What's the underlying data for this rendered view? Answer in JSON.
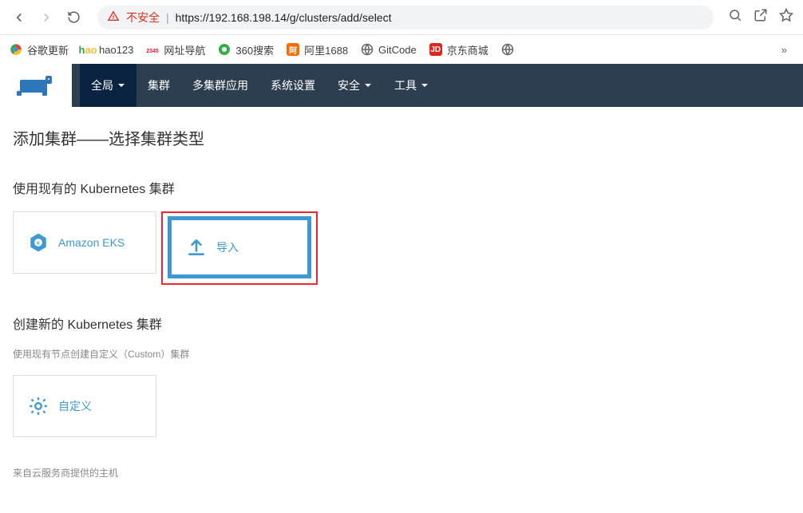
{
  "browser": {
    "insecure_label": "不安全",
    "url": "https://192.168.198.14/g/clusters/add/select"
  },
  "bookmarks": [
    {
      "label": "谷歌更新",
      "color": "#4285f4"
    },
    {
      "label": "hao123",
      "color": "#f8be30"
    },
    {
      "label": "网址导航",
      "color": "#3cba54"
    },
    {
      "label": "360搜索",
      "color": "#33b045"
    },
    {
      "label": "阿里1688",
      "color": "#ff6a00"
    },
    {
      "label": "GitCode",
      "color": "#666"
    },
    {
      "label": "京东商城",
      "color": "#e1251b"
    }
  ],
  "nav": {
    "global": "全局",
    "items": [
      "集群",
      "多集群应用",
      "系统设置",
      "安全",
      "工具"
    ]
  },
  "page": {
    "title": "添加集群——选择集群类型",
    "section1_title": "使用现有的 Kubernetes 集群",
    "card_eks": "Amazon EKS",
    "card_import": "导入",
    "section2_title": "创建新的 Kubernetes 集群",
    "section2_subtitle": "使用现有节点创建自定义（Custom）集群",
    "card_custom": "自定义",
    "footer": "来自云服务商提供的主机"
  }
}
